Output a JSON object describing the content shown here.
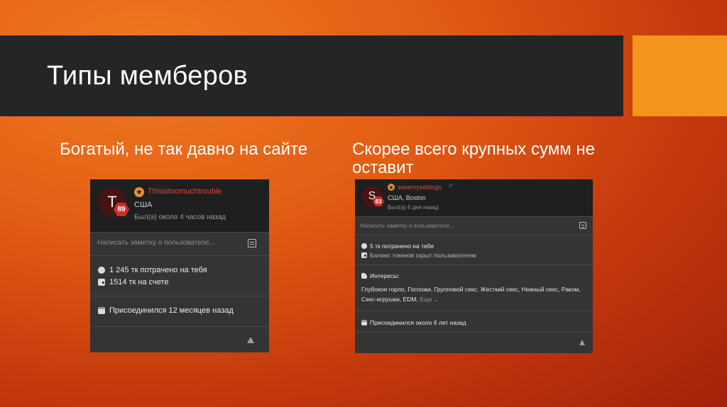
{
  "slide": {
    "title": "Типы мемберов",
    "colors": {
      "title_bar": "#252525",
      "accent": "#f3941c"
    }
  },
  "columns": [
    {
      "heading": "Богатый, не так давно на сайте",
      "card": {
        "avatar_letter": "T",
        "level": "89",
        "username": "Thisistoomuchtrouble",
        "location": "США",
        "last_seen": "Был(а) около 4 часов назад",
        "note_placeholder": "Написать заметку о пользователе...",
        "tokens_spent": "1 245 тк потрачено на тебя",
        "balance": "1514 тк на счете",
        "joined": "Присоединился 12 месяцев назад"
      }
    },
    {
      "heading": "Скорее всего крупных сумм не оставит",
      "card": {
        "avatar_letter": "S",
        "level": "83",
        "username": "savemysettings",
        "gender_symbol": "♂",
        "location": "США, Boston",
        "last_seen": "Был(а) 4 дня назад",
        "note_placeholder": "Написать заметку о пользователе...",
        "tokens_spent": "5 тк потрачено на тебя",
        "balance_hidden": "Баланс токенов скрыт пользователем",
        "interests_label": "Интересы:",
        "interests": "Глубокое горло, Госпожи, Групповой секс, Жесткий секс, Нежный секс, Раком, Секс-игрушки, EDM,",
        "more_label": "Еще ⌄",
        "joined": "Присоединился около 6 лет назад"
      }
    }
  ]
}
